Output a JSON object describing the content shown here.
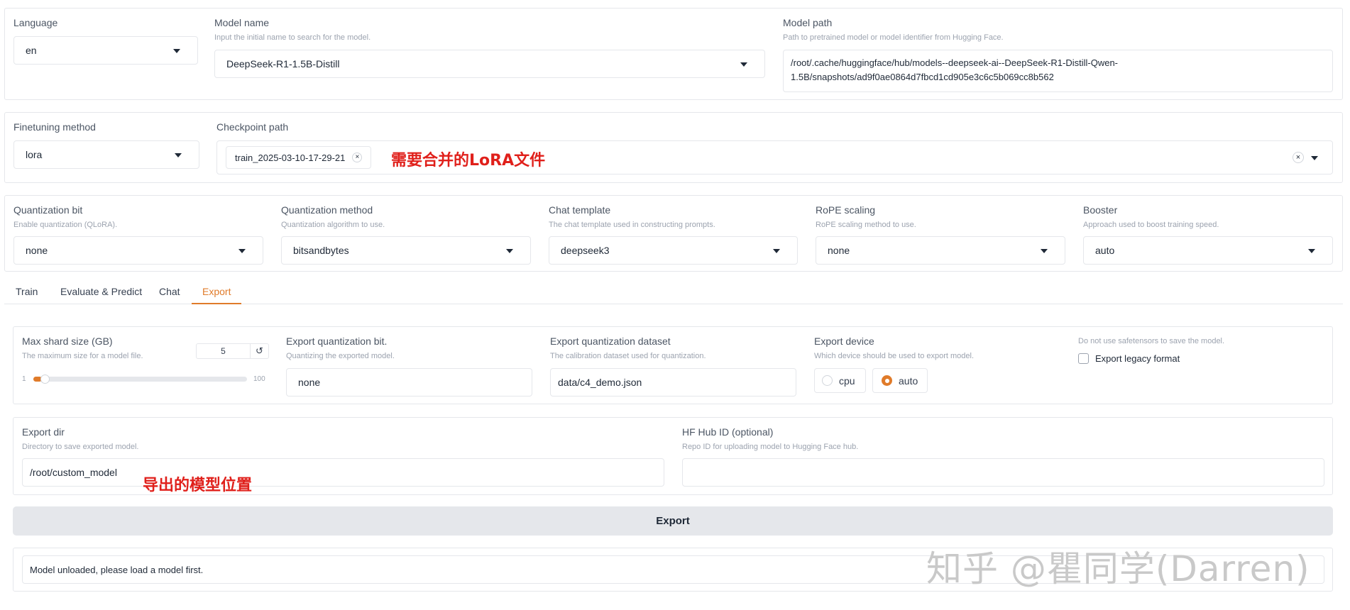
{
  "top": {
    "language": {
      "label": "Language",
      "value": "en"
    },
    "model_name": {
      "label": "Model name",
      "info": "Input the initial name to search for the model.",
      "value": "DeepSeek-R1-1.5B-Distill"
    },
    "model_path": {
      "label": "Model path",
      "info": "Path to pretrained model or model identifier from Hugging Face.",
      "value_line1": "/root/.cache/huggingface/hub/models--deepseek-ai--DeepSeek-R1-Distill-Qwen-",
      "value_line2": "1.5B/snapshots/ad9f0ae0864d7fbcd1cd905e3c6c5b069cc8b562"
    }
  },
  "finetune": {
    "method": {
      "label": "Finetuning method",
      "value": "lora"
    },
    "checkpoint": {
      "label": "Checkpoint path",
      "tag": "train_2025-03-10-17-29-21",
      "tag_close": "×",
      "clear": "×"
    }
  },
  "advanced": {
    "quant_bit": {
      "label": "Quantization bit",
      "info": "Enable quantization (QLoRA).",
      "value": "none"
    },
    "quant_method": {
      "label": "Quantization method",
      "info": "Quantization algorithm to use.",
      "value": "bitsandbytes"
    },
    "chat_template": {
      "label": "Chat template",
      "info": "The chat template used in constructing prompts.",
      "value": "deepseek3"
    },
    "rope": {
      "label": "RoPE scaling",
      "info": "RoPE scaling method to use.",
      "value": "none"
    },
    "booster": {
      "label": "Booster",
      "info": "Approach used to boost training speed.",
      "value": "auto"
    }
  },
  "tabs": [
    "Train",
    "Evaluate & Predict",
    "Chat",
    "Export"
  ],
  "export": {
    "shard": {
      "label": "Max shard size (GB)",
      "info": "The maximum size for a model file.",
      "value": "5",
      "reset": "↺",
      "min": "1",
      "max": "100",
      "level": 0.04
    },
    "quant_bit": {
      "label": "Export quantization bit.",
      "info": "Quantizing the exported model.",
      "value": "none"
    },
    "quant_dataset": {
      "label": "Export quantization dataset",
      "info": "The calibration dataset used for quantization.",
      "value": "data/c4_demo.json"
    },
    "device": {
      "label": "Export device",
      "info": "Which device should be used to export model.",
      "options": [
        "cpu",
        "auto"
      ],
      "selected": "auto"
    },
    "legacy": {
      "info": "Do not use safetensors to save the model.",
      "label": "Export legacy format",
      "checked": false
    },
    "dir": {
      "label": "Export dir",
      "info": "Directory to save exported model.",
      "value": "/root/custom_model"
    },
    "hub": {
      "label": "HF Hub ID (optional)",
      "info": "Repo ID for uploading model to Hugging Face hub.",
      "value": ""
    },
    "button": "Export",
    "status": "Model unloaded, please load a model first."
  },
  "annotations": {
    "lora": "需要合并的LoRA文件",
    "export_dir": "导出的模型位置"
  },
  "watermark": "知乎 @瞿同学(Darren)",
  "colors": {
    "accent": "#e07b2a",
    "annotation": "#e0201b",
    "button_bg": "#e5e7eb"
  }
}
